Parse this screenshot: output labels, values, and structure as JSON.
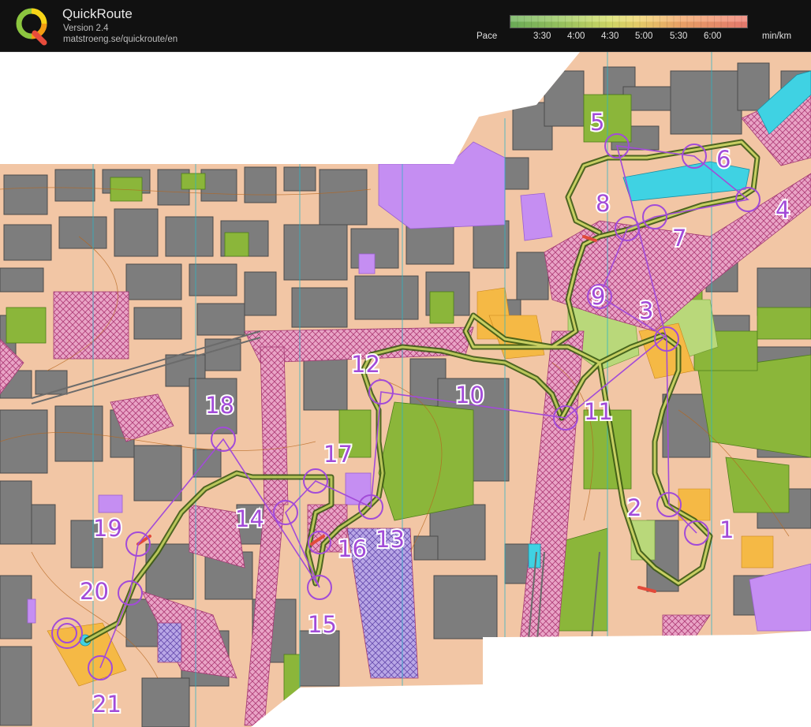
{
  "app": {
    "title": "QuickRoute",
    "version": "Version 2.4",
    "url": "matstroeng.se/quickroute/en"
  },
  "pace_legend": {
    "label": "Pace",
    "ticks": [
      "3:30",
      "4:00",
      "4:30",
      "5:00",
      "5:30",
      "6:00"
    ],
    "unit": "min/km",
    "colors": [
      "#6fb35b",
      "#9fcb63",
      "#d8e06a",
      "#f1d46e",
      "#f3a86a",
      "#ef7f73"
    ]
  },
  "map": {
    "course_color": "#a24bd8",
    "route_color": "#4f6b1f",
    "controls": [
      "1",
      "2",
      "3",
      "4",
      "5",
      "6",
      "7",
      "8",
      "9",
      "10",
      "11",
      "12",
      "13",
      "14",
      "15",
      "16",
      "17",
      "18",
      "19",
      "20",
      "21"
    ]
  }
}
